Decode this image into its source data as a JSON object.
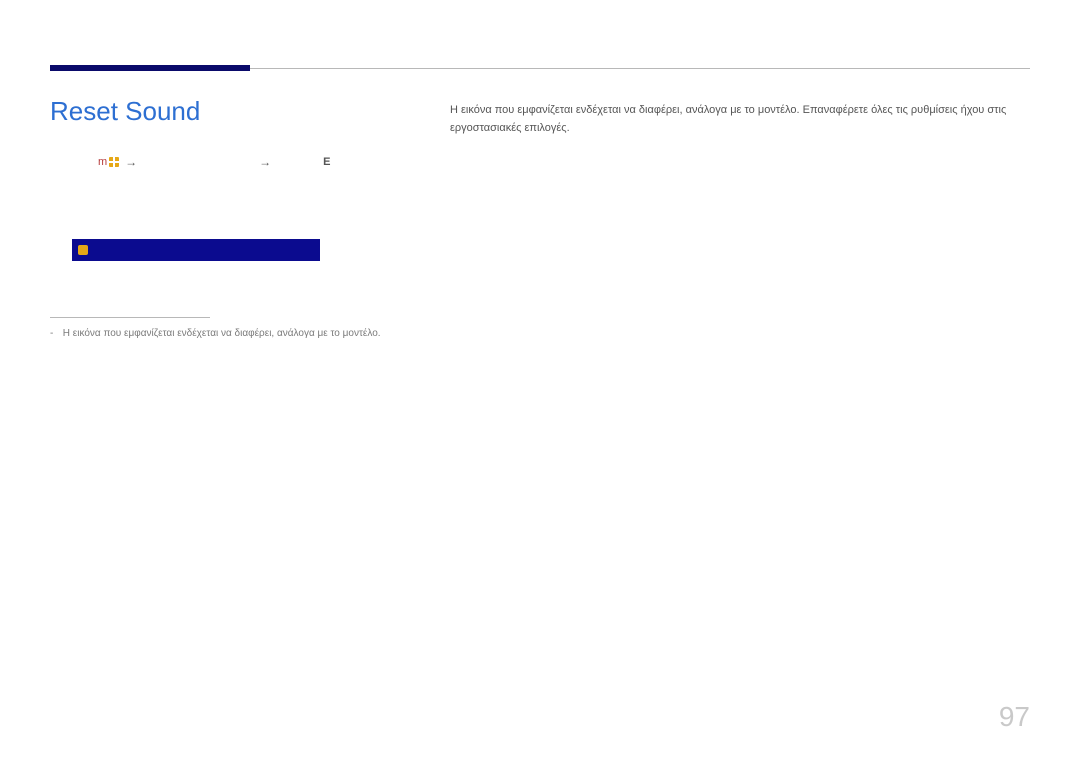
{
  "page": {
    "title": "Reset Sound",
    "number": "97"
  },
  "nav": {
    "menu_label": "m",
    "arrow": "→",
    "enter": "E"
  },
  "body": {
    "paragraph1": "Η εικόνα που εμφανίζεται ενδέχεται να διαφέρει, ανάλογα με το μοντέλο. Επαναφέρετε όλες τις ρυθμίσεις ήχου στις εργοστασιακές επιλογές."
  },
  "footnote": {
    "dash": "-",
    "text": "Η εικόνα που εμφανίζεται ενδέχεται να διαφέρει, ανάλογα με το μοντέλο."
  }
}
